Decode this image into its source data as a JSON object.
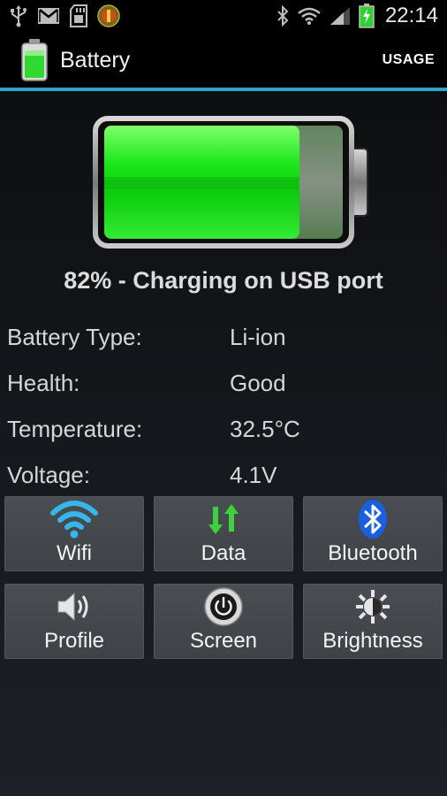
{
  "status_bar": {
    "time": "22:14",
    "left_icons": [
      "usb-icon",
      "gmail-icon",
      "sd-card-icon",
      "notification-app-icon"
    ],
    "right_icons": [
      "bluetooth-icon",
      "wifi-signal-icon",
      "cell-signal-icon",
      "battery-charging-icon"
    ]
  },
  "action_bar": {
    "title": "Battery",
    "usage_label": "USAGE",
    "accent_color": "#2aa3cf"
  },
  "battery": {
    "level_fraction": 0.82,
    "status_text": "82% - Charging on USB port"
  },
  "info": [
    {
      "label": "Battery Type:",
      "value": "Li-ion"
    },
    {
      "label": "Health:",
      "value": "Good"
    },
    {
      "label": "Temperature:",
      "value": "32.5°C"
    },
    {
      "label": "Voltage:",
      "value": "4.1V"
    }
  ],
  "toggles": [
    {
      "label": "Wifi",
      "icon": "wifi-icon"
    },
    {
      "label": "Data",
      "icon": "data-arrows-icon"
    },
    {
      "label": "Bluetooth",
      "icon": "bluetooth-icon"
    },
    {
      "label": "Profile",
      "icon": "speaker-icon"
    },
    {
      "label": "Screen",
      "icon": "power-icon"
    },
    {
      "label": "Brightness",
      "icon": "brightness-icon"
    }
  ],
  "colors": {
    "battery_green": "#1ee01e",
    "data_arrows_green": "#3ad43a",
    "wifi_blue": "#36b7ea",
    "bluetooth_blue": "#1a5fe0"
  }
}
